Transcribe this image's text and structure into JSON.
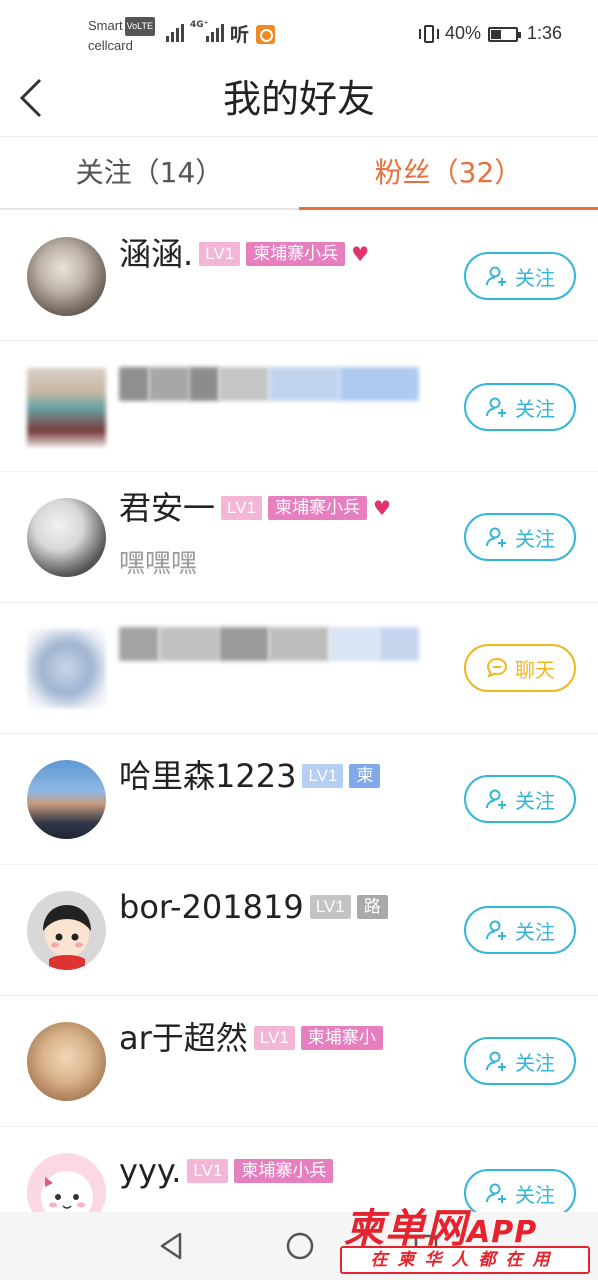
{
  "status_bar": {
    "carrier_name": "Smart",
    "volte": "VoLTE",
    "carrier_sub": "cellcard",
    "network": "4G⁺",
    "hd": "听",
    "battery_percent": "40%",
    "battery_level": 0.4,
    "time": "1:36"
  },
  "header": {
    "title": "我的好友"
  },
  "tabs": [
    {
      "label": "关注（14）",
      "active": false
    },
    {
      "label": "粉丝（32）",
      "active": true
    }
  ],
  "buttons": {
    "follow": "关注",
    "chat": "聊天"
  },
  "friends": [
    {
      "name": "涵涵.",
      "level": "LV1",
      "tag": "柬埔寨小兵",
      "heart": "♥",
      "button": "关注"
    },
    {
      "name": "",
      "button": "关注",
      "blurred": true
    },
    {
      "name": "君安一",
      "level": "LV1",
      "tag": "柬埔寨小兵",
      "heart": "♥",
      "signature": "嘿嘿嘿",
      "button": "关注"
    },
    {
      "name": "",
      "button": "聊天",
      "blurred": true
    },
    {
      "name": "哈里森1223",
      "level": "LV1",
      "tag": "柬",
      "button": "关注"
    },
    {
      "name": "bor-201819",
      "level": "LV1",
      "tag": "路",
      "button": "关注"
    },
    {
      "name": "ar于超然",
      "level": "LV1",
      "tag": "柬埔寨小",
      "button": "关注"
    },
    {
      "name": "yyy.",
      "level": "LV1",
      "tag": "柬埔寨小兵",
      "button": "关注"
    }
  ],
  "watermark": {
    "brand": "柬单网",
    "app": "APP",
    "slogan": "在柬华人都在用"
  },
  "colors": {
    "accent": "#e8703a",
    "follow_button": "#35b6d6",
    "chat_button": "#f1b81e",
    "watermark": "#e5222d"
  }
}
